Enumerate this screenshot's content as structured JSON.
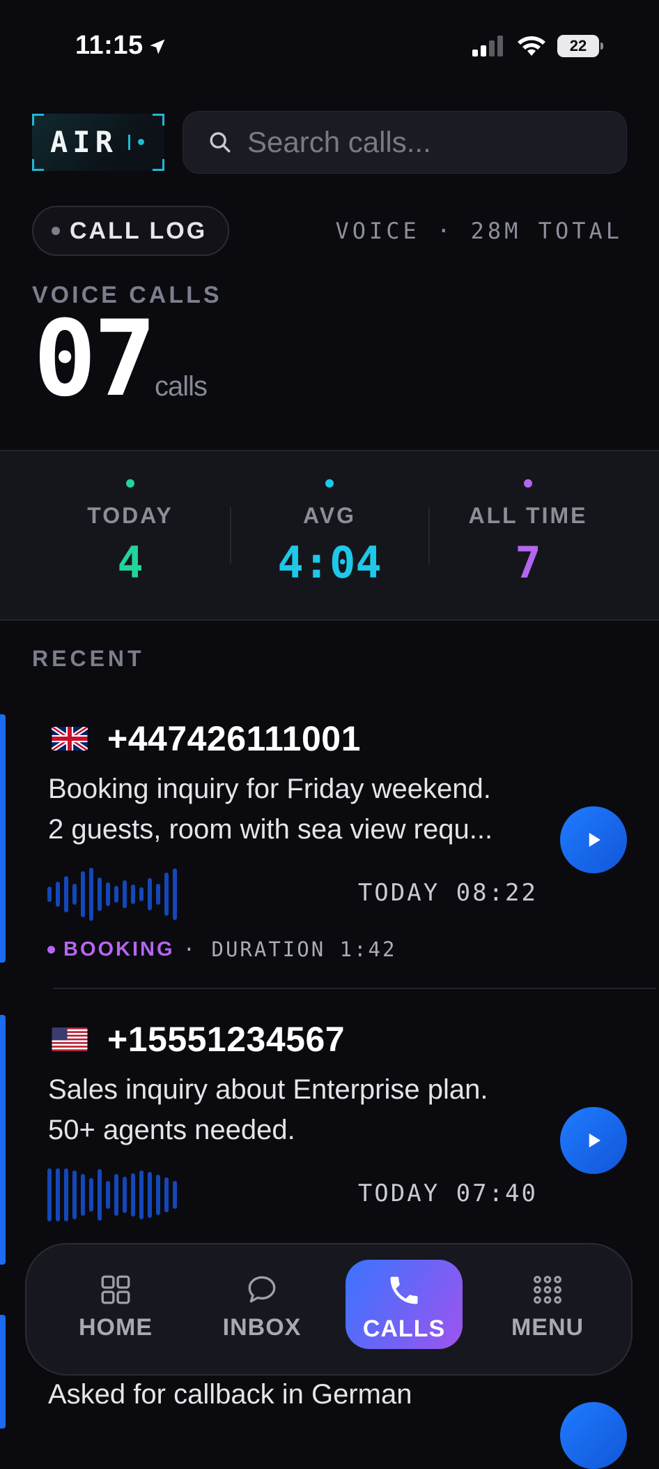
{
  "status_bar": {
    "time": "11:15",
    "battery": "22"
  },
  "header": {
    "logo_text": "AIR",
    "search_placeholder": "Search calls..."
  },
  "summary": {
    "pill_label": "CALL LOG",
    "meta": "VOICE · 28M TOTAL",
    "section_label": "VOICE CALLS",
    "count": "07",
    "unit": "calls"
  },
  "stats": [
    {
      "label": "TODAY",
      "value": "4",
      "color": "#22d39a"
    },
    {
      "label": "AVG",
      "value": "4:04",
      "color": "#1ec8e8"
    },
    {
      "label": "ALL TIME",
      "value": "7",
      "color": "#b566ef"
    }
  ],
  "recent_label": "RECENT",
  "calls": [
    {
      "flag": "uk-flag",
      "phone": "+447426111001",
      "summary_line1": "Booking inquiry for Friday weekend.",
      "summary_line2": "2 guests, room with sea view requ...",
      "when": "TODAY 08:22",
      "tag": "BOOKING",
      "duration": "· DURATION 1:42"
    },
    {
      "flag": "us-flag",
      "phone": "+15551234567",
      "summary_line1": "Sales inquiry about Enterprise plan.",
      "summary_line2": "50+ agents needed.",
      "when": "TODAY 07:40"
    },
    {
      "summary_line1": "Asked for callback in German"
    }
  ],
  "nav": [
    {
      "label": "HOME",
      "icon": "grid-icon"
    },
    {
      "label": "INBOX",
      "icon": "chat-bubble-icon"
    },
    {
      "label": "CALLS",
      "icon": "phone-icon",
      "active": true
    },
    {
      "label": "MENU",
      "icon": "dots-grid-icon"
    }
  ]
}
